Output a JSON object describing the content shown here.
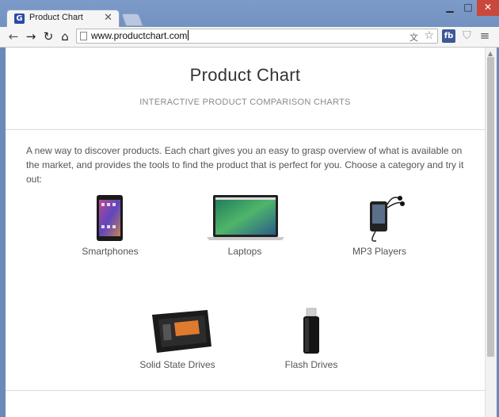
{
  "browser": {
    "tab_title": "Product Chart",
    "tab_favicon": "G",
    "url": "www.productchart.com"
  },
  "page": {
    "title": "Product Chart",
    "subtitle": "INTERACTIVE PRODUCT COMPARISON CHARTS",
    "intro": "A new way to discover products. Each chart gives you an easy to grasp overview of what is available on the market, and provides the tools to find the product that is perfect for you. Choose a category and try it out:",
    "categories": [
      {
        "label": "Smartphones",
        "icon": "smartphone-icon"
      },
      {
        "label": "Laptops",
        "icon": "laptop-icon"
      },
      {
        "label": "MP3 Players",
        "icon": "mp3-player-icon"
      },
      {
        "label": "Solid State Drives",
        "icon": "ssd-icon"
      },
      {
        "label": "Flash Drives",
        "icon": "flash-drive-icon"
      }
    ]
  },
  "colors": {
    "window_frame": "#6f8fbf",
    "close_button": "#c9483c",
    "facebook": "#3b5998"
  }
}
